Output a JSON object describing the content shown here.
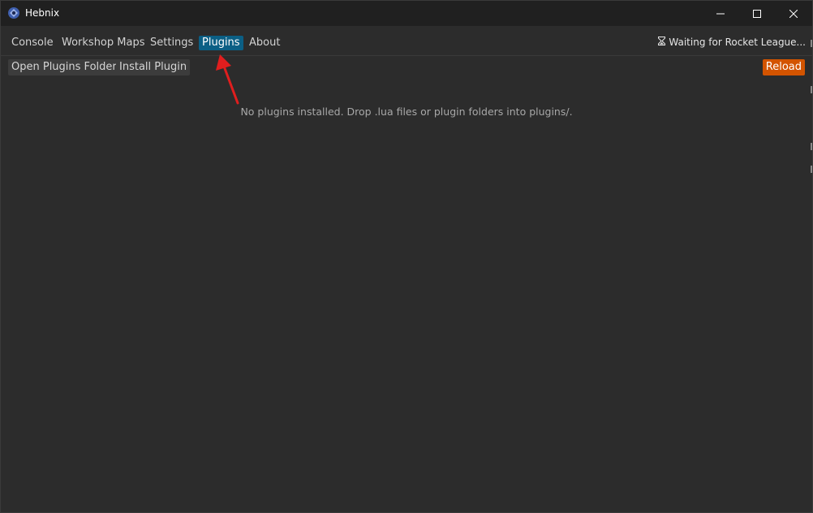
{
  "window": {
    "title": "Hebnix",
    "controls": {
      "minimize": "minimize",
      "maximize": "maximize",
      "close": "close"
    }
  },
  "menu": {
    "items": [
      {
        "label": "Console",
        "active": false
      },
      {
        "label": "Workshop Maps",
        "active": false
      },
      {
        "label": "Settings",
        "active": false
      },
      {
        "label": "Plugins",
        "active": true
      },
      {
        "label": "About",
        "active": false
      }
    ],
    "status": {
      "icon": "hourglass-icon",
      "text": "Waiting for Rocket League..."
    }
  },
  "toolbar": {
    "open_folder_label": "Open Plugins Folder",
    "install_label": "Install Plugin",
    "reload_label": "Reload"
  },
  "main": {
    "empty_message": "No plugins installed. Drop .lua files or plugin folders into plugins/."
  },
  "colors": {
    "accent_tab": "#0b5f85",
    "reload": "#d35400",
    "annotation_arrow": "#e01e1e"
  }
}
